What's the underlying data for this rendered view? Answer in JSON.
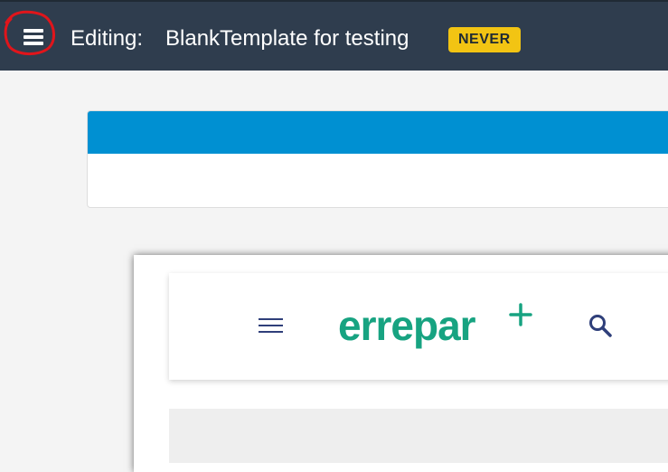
{
  "topbar": {
    "editing_label": "Editing:",
    "template_name": "BlankTemplate for testing",
    "badge": "NEVER",
    "menu_icon": "hamburger-menu-icon",
    "highlight_color": "#e0151b"
  },
  "panel": {
    "accent_color": "#0090d2"
  },
  "preview": {
    "logo_text": "errepar",
    "logo_plus": "+",
    "logo_color": "#17a381",
    "menu_icon": "hamburger-menu-icon",
    "search_icon": "search-icon"
  }
}
